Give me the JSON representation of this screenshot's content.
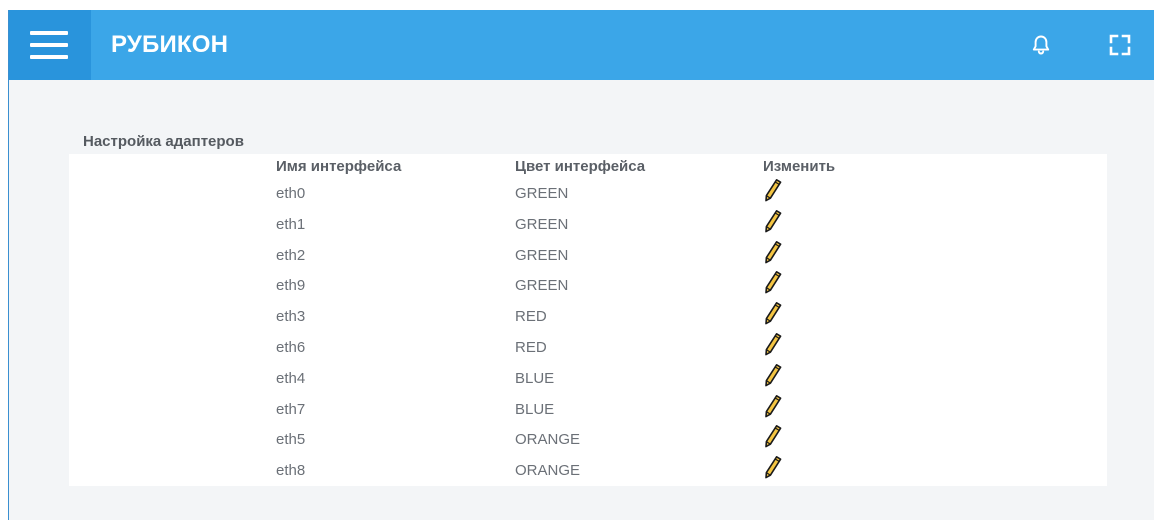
{
  "header": {
    "app_title": "РУБИКОН",
    "menu_icon": "hamburger-menu-icon",
    "bell_icon": "bell-icon",
    "fullscreen_icon": "fullscreen-icon",
    "color": "#3ba6e8",
    "menu_color": "#2994dc"
  },
  "section": {
    "title": "Настройка адаптеров"
  },
  "table": {
    "columns": [
      "Имя интерфейса",
      "Цвет интерфейса",
      "Изменить"
    ],
    "edit_icon": "pencil-icon",
    "rows": [
      {
        "name": "eth0",
        "color": "GREEN"
      },
      {
        "name": "eth1",
        "color": "GREEN"
      },
      {
        "name": "eth2",
        "color": "GREEN"
      },
      {
        "name": "eth9",
        "color": "GREEN"
      },
      {
        "name": "eth3",
        "color": "RED"
      },
      {
        "name": "eth6",
        "color": "RED"
      },
      {
        "name": "eth4",
        "color": "BLUE"
      },
      {
        "name": "eth7",
        "color": "BLUE"
      },
      {
        "name": "eth5",
        "color": "ORANGE"
      },
      {
        "name": "eth8",
        "color": "ORANGE"
      }
    ]
  }
}
